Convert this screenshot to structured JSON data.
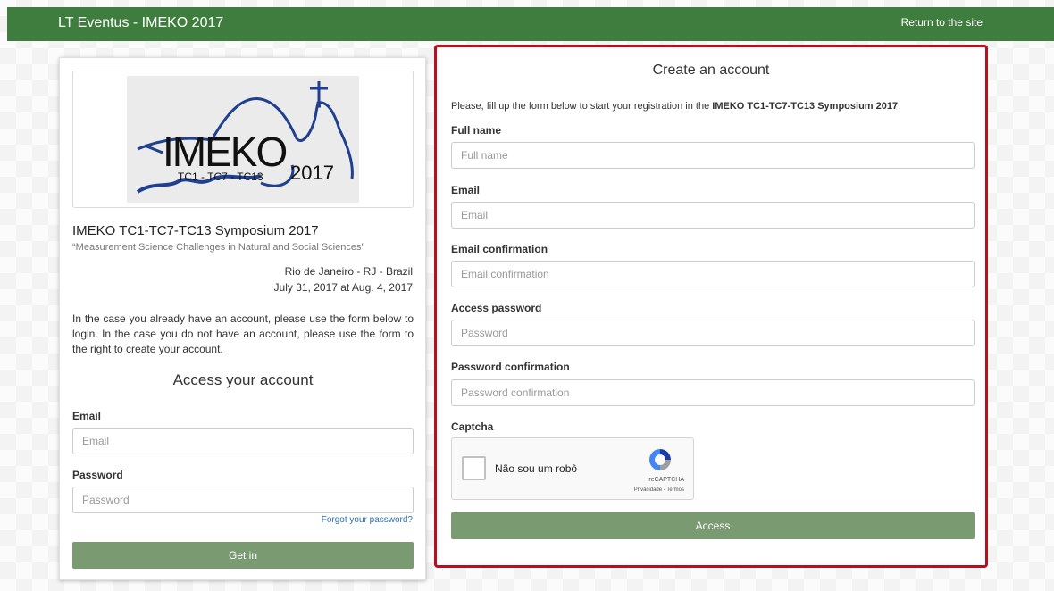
{
  "header": {
    "brand": "LT Eventus - IMEKO 2017",
    "return_link": "Return to the site"
  },
  "event": {
    "logo": {
      "word": "IMEKO",
      "committees": "TC1 - TC7 - TC13",
      "year": "2017"
    },
    "title": "IMEKO TC1-TC7-TC13 Symposium 2017",
    "subtitle": "“Measurement Science Challenges in Natural and Social Sciences”",
    "location": "Rio de Janeiro - RJ - Brazil",
    "dates": "July 31, 2017 at Aug. 4, 2017",
    "info": "In the case you already have an account, please use the form below to login. In the case you do not have an account, please use the form to the right to create your account."
  },
  "login": {
    "title": "Access your account",
    "email_label": "Email",
    "email_placeholder": "Email",
    "password_label": "Password",
    "password_placeholder": "Password",
    "forgot": "Forgot your password?",
    "submit": "Get in"
  },
  "register": {
    "title": "Create an account",
    "intro_prefix": "Please, fill up the form below to start your registration in the ",
    "intro_event": "IMEKO TC1-TC7-TC13 Symposium 2017",
    "intro_suffix": ".",
    "fields": [
      {
        "label": "Full name",
        "placeholder": "Full name"
      },
      {
        "label": "Email",
        "placeholder": "Email"
      },
      {
        "label": "Email confirmation",
        "placeholder": "Email confirmation"
      },
      {
        "label": "Access password",
        "placeholder": "Password"
      },
      {
        "label": "Password confirmation",
        "placeholder": "Password confirmation"
      }
    ],
    "captcha_label": "Captcha",
    "captcha": {
      "checkbox_label": "Não sou um robô",
      "brand": "reCAPTCHA",
      "terms": "Privacidade - Termos"
    },
    "submit": "Access"
  },
  "colors": {
    "header_green": "#3f7d3f",
    "button_green": "#7a9a72",
    "highlight_red": "#b80f1c",
    "link_blue": "#2a6fb0"
  }
}
